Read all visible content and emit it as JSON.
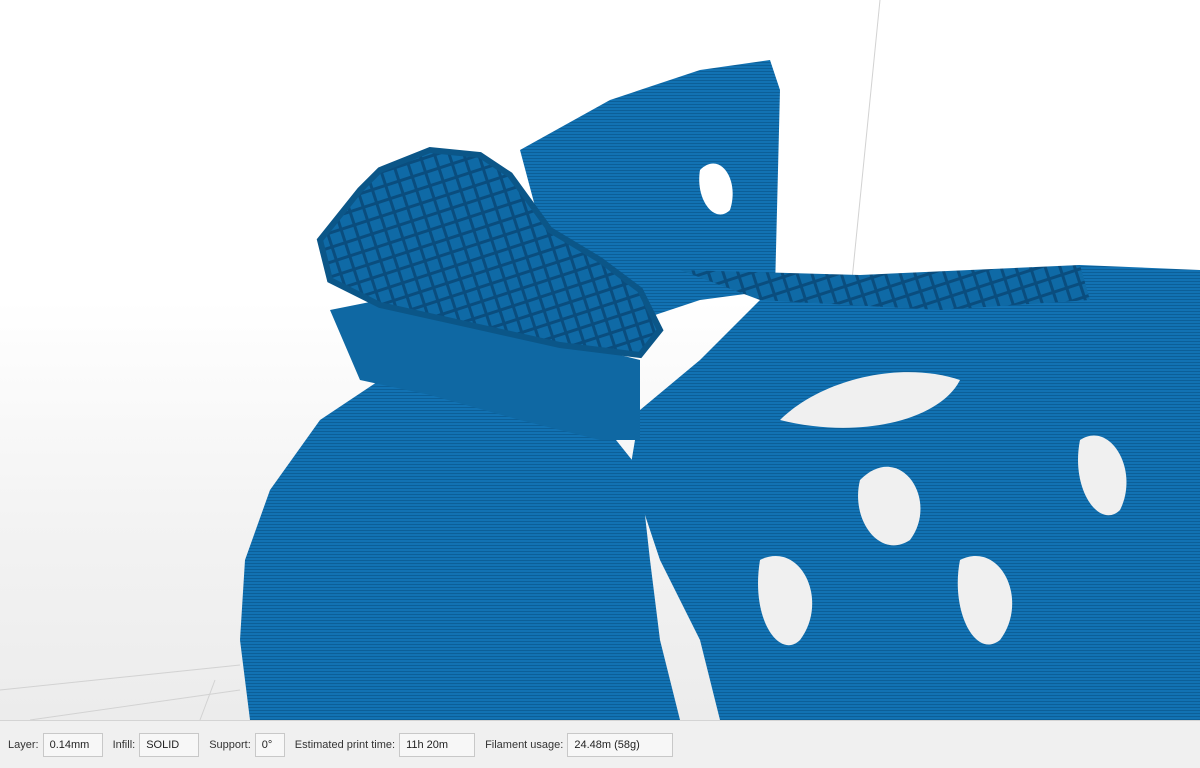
{
  "status_bar": {
    "layer_label": "Layer:",
    "layer_value": "0.14mm",
    "infill_label": "Infill:",
    "infill_value": "SOLID",
    "support_label": "Support:",
    "support_value": "0°",
    "print_time_label": "Estimated print time:",
    "print_time_value": "11h 20m",
    "filament_label": "Filament usage:",
    "filament_value": "24.48m (58g)"
  },
  "colors": {
    "model": "#0f6fae",
    "model_dark": "#0a4f80",
    "model_light": "#2a8cc8",
    "background": "#ffffff",
    "status_bar": "#f0f0f0"
  }
}
